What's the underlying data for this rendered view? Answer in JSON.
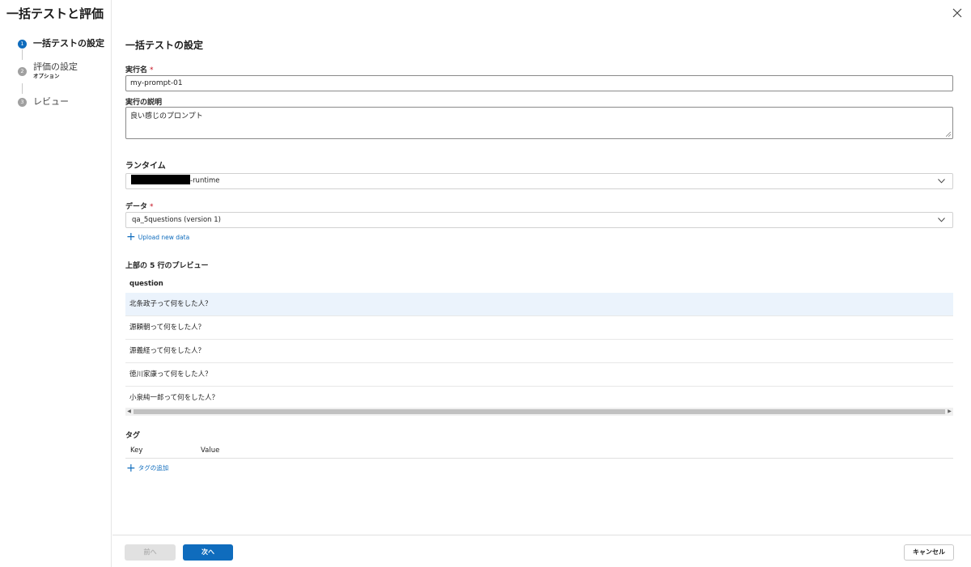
{
  "dialog": {
    "title": "一括テストと評価",
    "close_icon": "close-icon"
  },
  "steps": [
    {
      "number": "1",
      "label": "一括テストの設定",
      "sublabel": "",
      "active": true
    },
    {
      "number": "2",
      "label": "評価の設定",
      "sublabel": "オプション",
      "active": false
    },
    {
      "number": "3",
      "label": "レビュー",
      "sublabel": "",
      "active": false
    }
  ],
  "form": {
    "section_title": "一括テストの設定",
    "run_name": {
      "label": "実行名",
      "required_mark": "*",
      "value": "my-prompt-01"
    },
    "description": {
      "label": "実行の説明",
      "value": "良い感じのプロンプト"
    },
    "runtime": {
      "label": "ランタイム",
      "value_suffix": "-runtime",
      "redacted": true,
      "chevron_icon": "chevron-down-icon"
    },
    "data": {
      "label": "データ",
      "required_mark": "*",
      "value": "qa_5questions (version 1)",
      "chevron_icon": "chevron-down-icon",
      "upload_link": "Upload new data",
      "upload_icon": "plus-icon"
    }
  },
  "preview": {
    "title": "上部の 5 行のプレビュー",
    "column": "question",
    "rows": [
      "北条政子って何をした人？",
      "源頼朝って何をした人？",
      "源義経って何をした人？",
      "徳川家康って何をした人？",
      "小泉純一郎って何をした人？"
    ],
    "selected_row": 0
  },
  "tags": {
    "title": "タグ",
    "columns": [
      "Key",
      "Value"
    ],
    "add_link": "タグの追加",
    "add_icon": "plus-icon"
  },
  "footer": {
    "prev_label": "前へ",
    "next_label": "次へ",
    "cancel_label": "キャンセル"
  },
  "colors": {
    "accent": "#0f6cbd",
    "required": "#c50f1f",
    "selected_row": "#ebf3fc"
  }
}
